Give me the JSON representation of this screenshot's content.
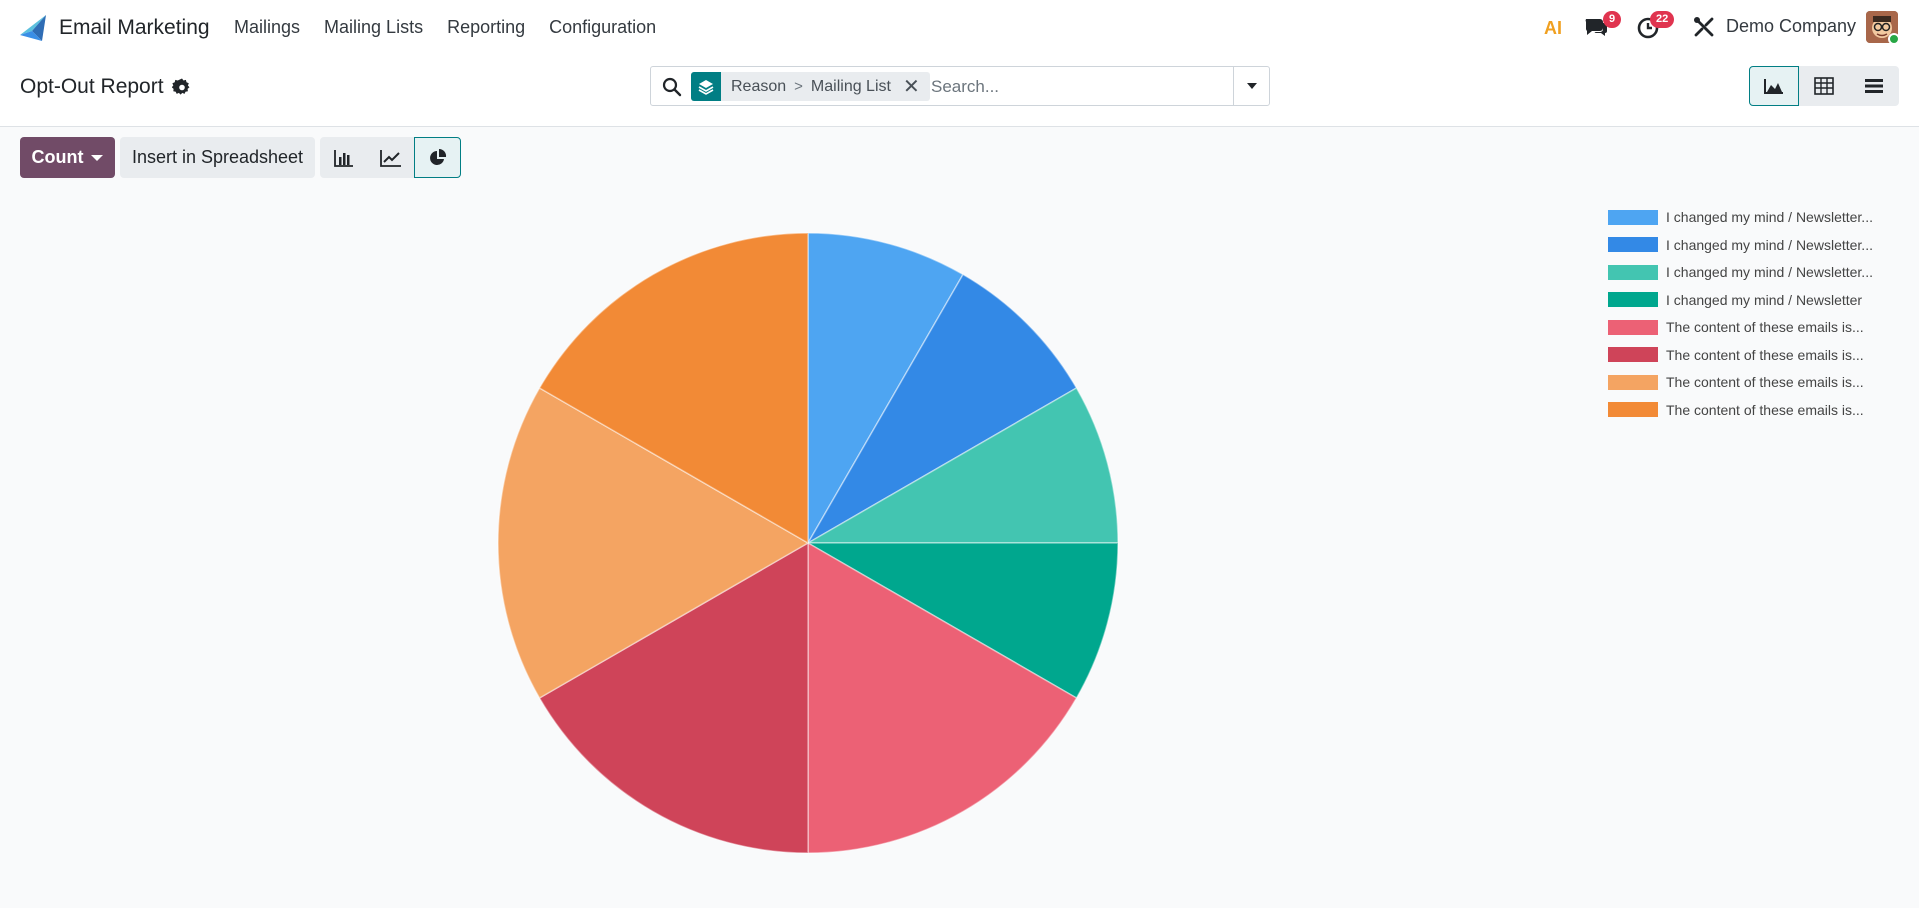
{
  "navbar": {
    "app_name": "Email Marketing",
    "menu": [
      "Mailings",
      "Mailing Lists",
      "Reporting",
      "Configuration"
    ],
    "ai_label": "AI",
    "messages_badge": "9",
    "activities_badge": "22",
    "company": "Demo Company"
  },
  "control_panel": {
    "title": "Opt-Out Report",
    "search": {
      "facet_parts": [
        "Reason",
        ">",
        "Mailing List"
      ],
      "placeholder": "Search..."
    },
    "views": [
      "graph-icon",
      "pivot-icon",
      "list-icon"
    ]
  },
  "toolbar": {
    "measure_label": "Count",
    "spreadsheet_label": "Insert in Spreadsheet",
    "chart_types": [
      "bar-chart-icon",
      "line-chart-icon",
      "pie-chart-icon"
    ]
  },
  "chart_data": {
    "type": "pie",
    "labels": [
      "I changed my mind / Newsletter...",
      "I changed my mind / Newsletter...",
      "I changed my mind / Newsletter...",
      "I changed my mind / Newsletter",
      "The content of these emails is...",
      "The content of these emails is...",
      "The content of these emails is...",
      "The content of these emails is..."
    ],
    "values": [
      1,
      1,
      1,
      1,
      2,
      2,
      2,
      2
    ],
    "colors": [
      "#4ea5f2",
      "#3389e6",
      "#43c5b1",
      "#00a78e",
      "#ec6175",
      "#cf4459",
      "#f4a462",
      "#f28a36"
    ],
    "legend_position": "top-right"
  }
}
